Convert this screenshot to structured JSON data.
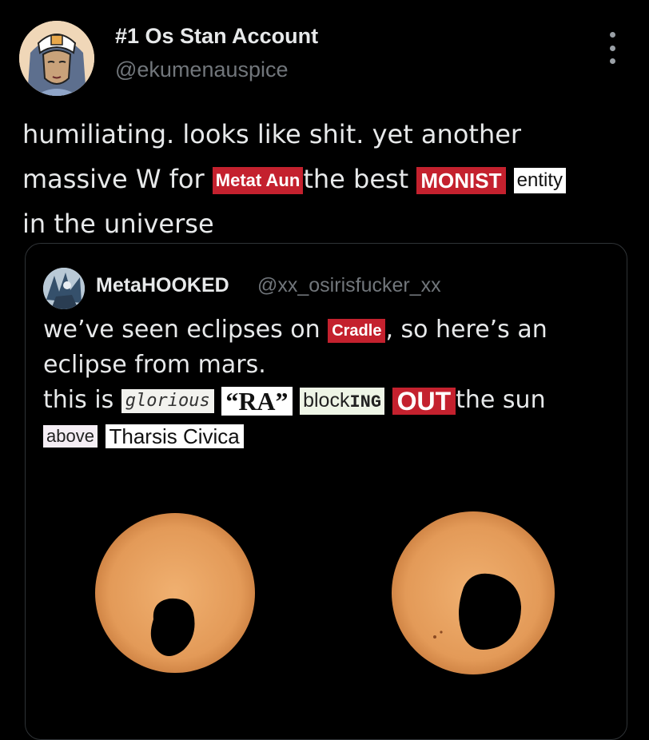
{
  "author": {
    "display_name": "#1 Os Stan Account",
    "handle": "@ekumenauspice"
  },
  "post": {
    "line1": "humiliating. looks like shit. yet another",
    "line2_a": "massive W for",
    "cut_metat": "Metat Aun",
    "line2_b": "the best",
    "cut_monist": "MONIST",
    "cut_entity": "entity",
    "line3": "in the universe"
  },
  "quoted": {
    "display_name": "MetaHOOKED",
    "handle": "@xx_osirisfucker_xx",
    "l1_a": "we’ve seen eclipses on",
    "cut_cradle": "Cradle",
    "l1_b": ", so here’s an",
    "l2": "eclipse from mars.",
    "l3_a": "this is",
    "cut_glorious": "glorious",
    "cut_ra": "“RA”",
    "cut_block": "block",
    "cut_ing": "ING",
    "cut_out": "OUT",
    "l3_b": "the sun",
    "cut_above": "above",
    "cut_tharsis": "Tharsis Civica"
  },
  "icons": {
    "more": "more-options-icon"
  },
  "colors": {
    "background": "#000000",
    "text": "#e7e9ea",
    "muted": "#71767b",
    "cutout_red": "#c4212e",
    "sun": "#e09a5c"
  }
}
